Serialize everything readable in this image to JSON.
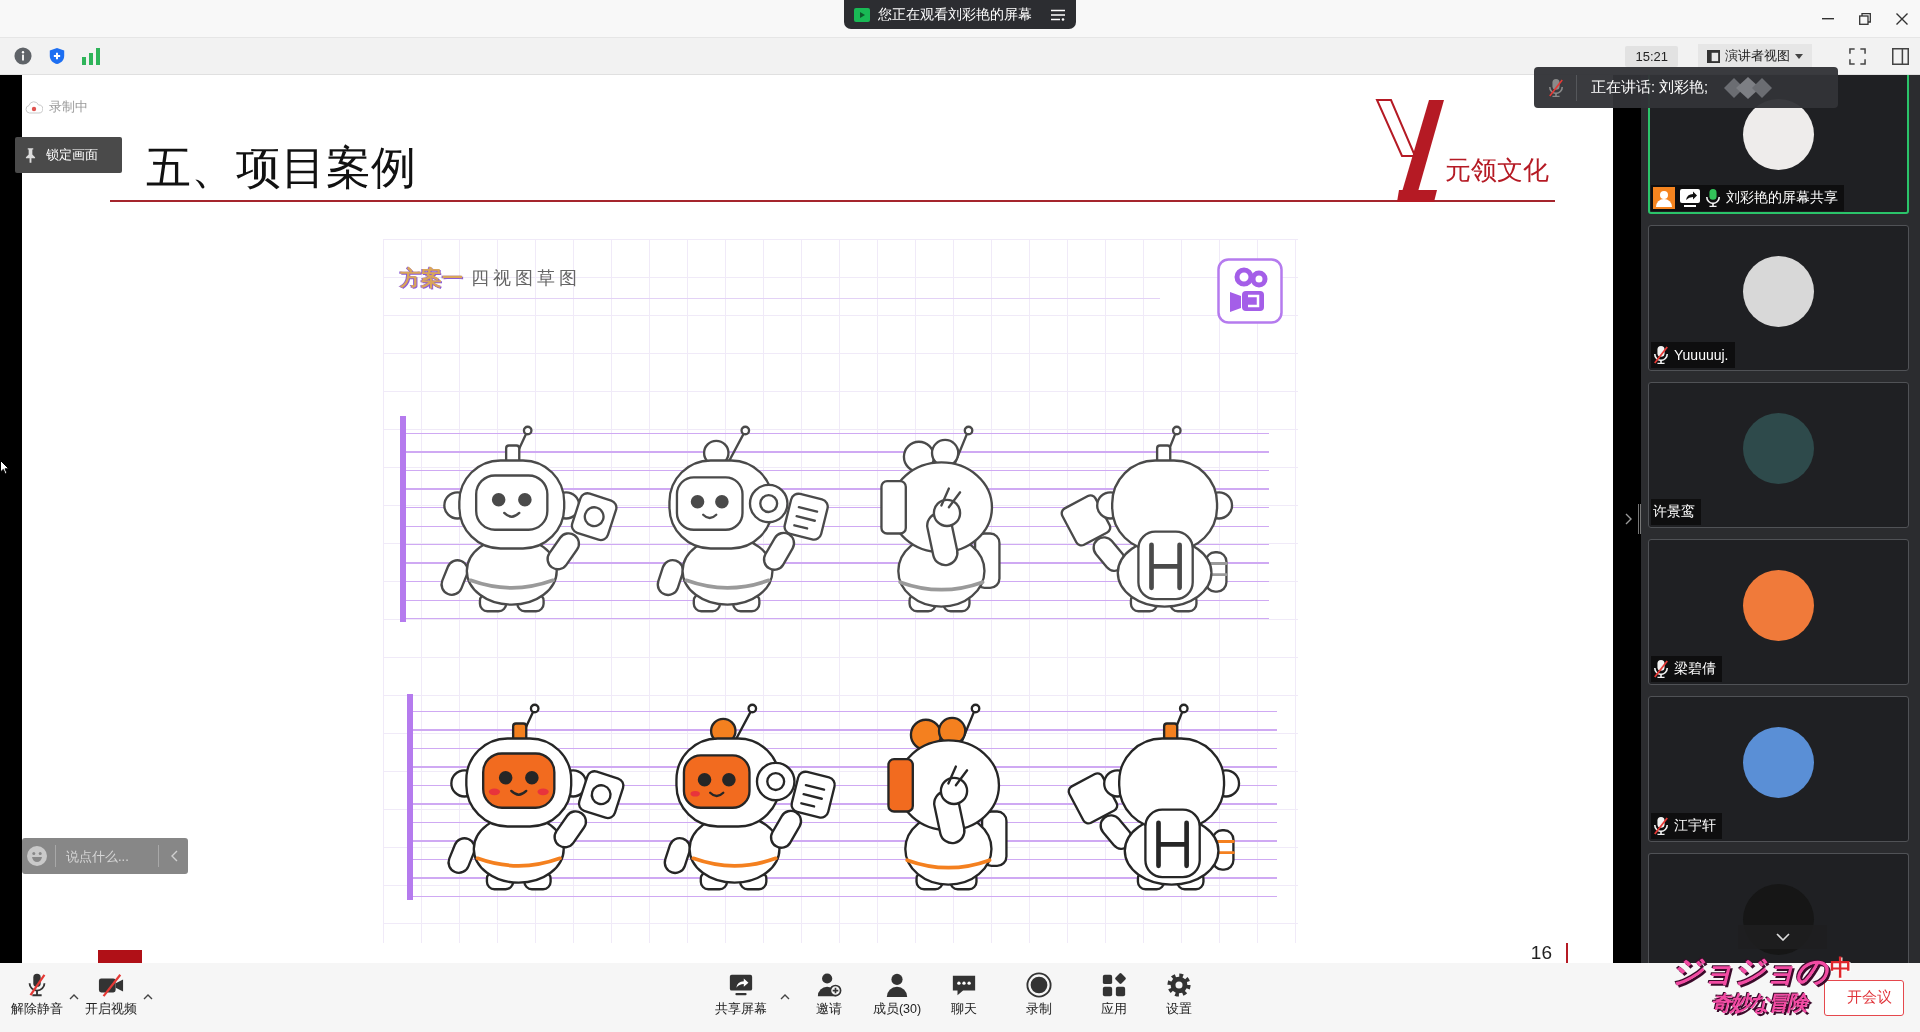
{
  "title_bar": {
    "banner": "您正在观看刘彩艳的屏幕"
  },
  "toolbar": {
    "time": "15:21",
    "view_menu": "演讲者视图"
  },
  "speaking_toast": {
    "text": "正在讲话: 刘彩艳;"
  },
  "screen_overlay": {
    "recording": "录制中",
    "lock_button": "锁定画面"
  },
  "slide": {
    "title": "五、项目案例",
    "logo_text": "元领文化",
    "sheet": {
      "tag": "方案一",
      "heading": "四视图草图",
      "rows": [
        {
          "kind": "sketch",
          "figures": [
            {
              "kind": "front"
            },
            {
              "kind": "three-quarter"
            },
            {
              "kind": "side"
            },
            {
              "kind": "back"
            }
          ]
        },
        {
          "kind": "color",
          "figures": [
            {
              "kind": "front"
            },
            {
              "kind": "three-quarter"
            },
            {
              "kind": "side"
            },
            {
              "kind": "back"
            }
          ]
        }
      ]
    },
    "page": "16"
  },
  "chat": {
    "placeholder": "说点什么..."
  },
  "participants": [
    {
      "name": "刘彩艳的屏幕共享",
      "color": "#eeeceb",
      "host": true,
      "sharing": true,
      "mic_on": true,
      "muted": false,
      "active": true
    },
    {
      "name": "Yuuuuuj.",
      "color": "#d8d8d8",
      "host": false,
      "sharing": false,
      "mic_on": false,
      "muted": true,
      "active": false
    },
    {
      "name": "许景鸾",
      "color": "#2e4a4b",
      "host": false,
      "sharing": false,
      "mic_on": false,
      "muted": false,
      "active": false
    },
    {
      "name": "梁碧倩",
      "color": "#f07a3a",
      "host": false,
      "sharing": false,
      "mic_on": false,
      "muted": true,
      "active": false
    },
    {
      "name": "江宇轩",
      "color": "#5a8fd6",
      "host": false,
      "sharing": false,
      "mic_on": false,
      "muted": true,
      "active": false
    },
    {
      "color": "#161616",
      "host": false,
      "sharing": false,
      "mic_on": false,
      "muted": false,
      "active": false
    }
  ],
  "controls_left": [
    {
      "kind": "mic",
      "label": "解除静音",
      "off": true,
      "has_menu": true
    },
    {
      "kind": "camera",
      "label": "开启视频",
      "off": true,
      "has_menu": true
    }
  ],
  "controls_center": [
    {
      "kind": "share",
      "label": "共享屏幕",
      "has_menu": true
    },
    {
      "kind": "invite",
      "label": "邀请",
      "has_menu": false
    },
    {
      "kind": "members",
      "label": "成员(30)",
      "has_menu": false
    },
    {
      "kind": "chat",
      "label": "聊天",
      "has_menu": false
    },
    {
      "kind": "record",
      "label": "录制",
      "has_menu": false
    },
    {
      "kind": "apps",
      "label": "应用",
      "has_menu": false
    },
    {
      "kind": "settings",
      "label": "设置",
      "has_menu": false
    }
  ],
  "leave_button": {
    "label": "开会议"
  },
  "sticker": {
    "title": "ジョジョの",
    "subtitle": "奇妙な冒険",
    "badge": "中"
  }
}
